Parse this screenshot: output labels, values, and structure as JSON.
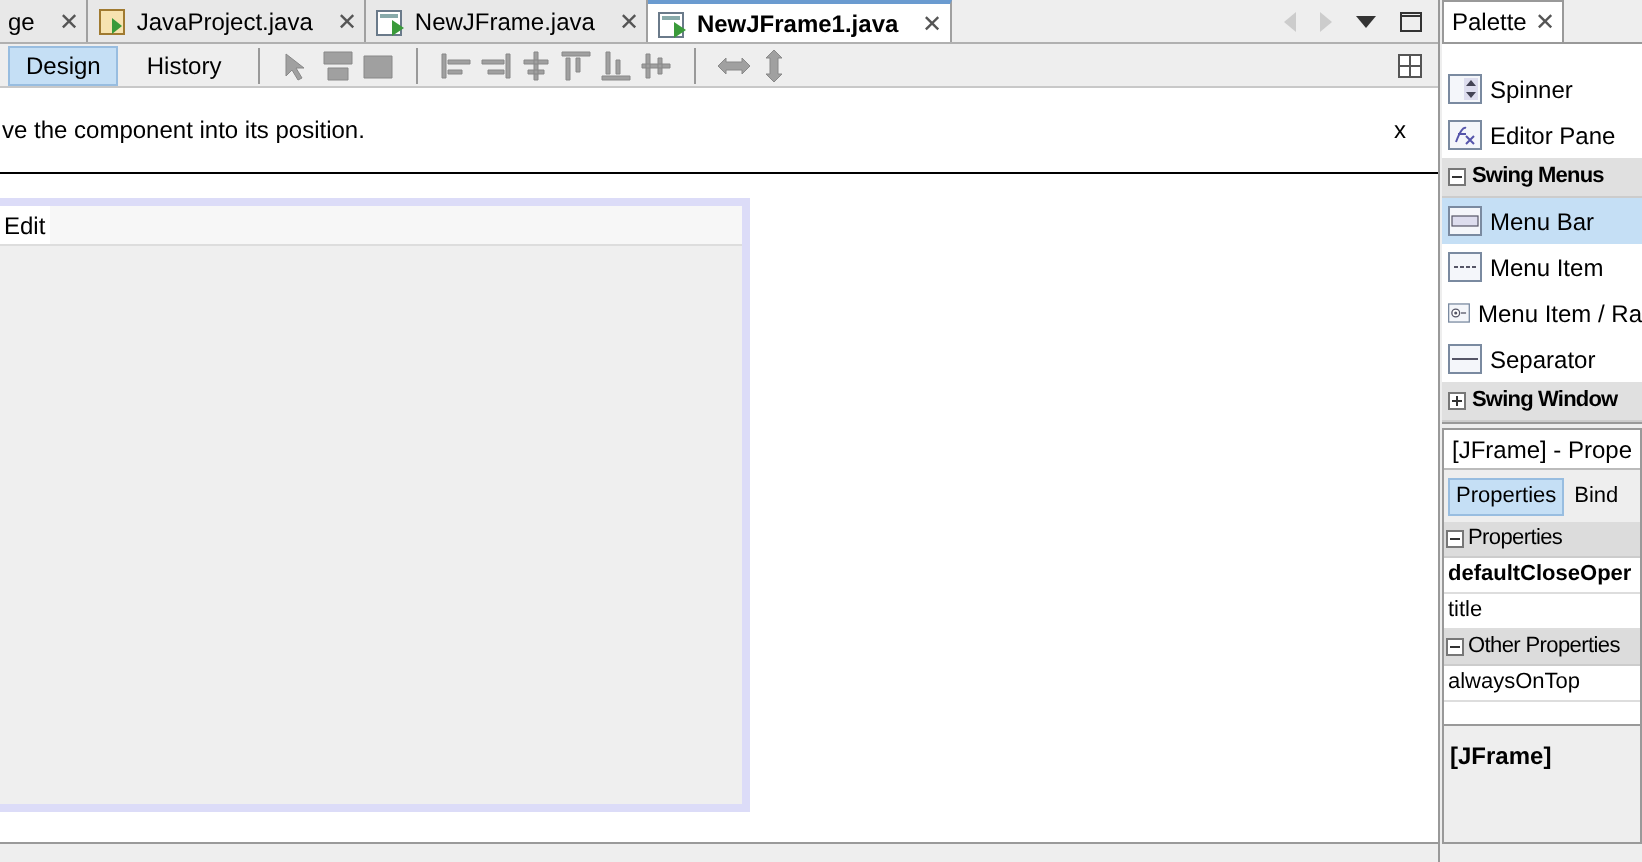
{
  "editor_tabs": [
    {
      "label": "ge",
      "selected": false,
      "close": "✕"
    },
    {
      "label": "JavaProject.java",
      "selected": false,
      "close": "✕"
    },
    {
      "label": "NewJFrame.java",
      "selected": false,
      "close": "✕"
    },
    {
      "label": "NewJFrame1.java",
      "selected": true,
      "close": "✕"
    }
  ],
  "view_tabs": [
    {
      "label": "Design",
      "selected": true
    },
    {
      "label": "History",
      "selected": false
    }
  ],
  "hint": {
    "text": "ve the component into its position.",
    "close": "x"
  },
  "form": {
    "menu_item": "Edit"
  },
  "palette": {
    "title": "Palette",
    "close": "✕",
    "items": [
      {
        "kind": "item",
        "label": "Spinner",
        "selected": false
      },
      {
        "kind": "item",
        "label": "Editor Pane",
        "selected": false
      },
      {
        "kind": "category",
        "label": "Swing Menus",
        "expanded": true
      },
      {
        "kind": "item",
        "label": "Menu Bar",
        "selected": true
      },
      {
        "kind": "item",
        "label": "Menu Item",
        "selected": false
      },
      {
        "kind": "item",
        "label": "Menu Item / Ra",
        "selected": false
      },
      {
        "kind": "item",
        "label": "Separator",
        "selected": false
      },
      {
        "kind": "category",
        "label": "Swing Window",
        "expanded": false
      }
    ]
  },
  "properties": {
    "title": "[JFrame] - Prope",
    "tabs": [
      {
        "label": "Properties",
        "selected": true
      },
      {
        "label": "Bind",
        "selected": false
      }
    ],
    "sections": [
      {
        "label": "Properties",
        "expanded": true,
        "rows": [
          {
            "name": "defaultCloseOper",
            "bold": true
          },
          {
            "name": "title",
            "bold": false
          }
        ]
      },
      {
        "label": "Other Properties",
        "expanded": true,
        "rows": [
          {
            "name": "alwaysOnTop",
            "bold": false
          }
        ]
      }
    ],
    "description": "[JFrame]"
  }
}
